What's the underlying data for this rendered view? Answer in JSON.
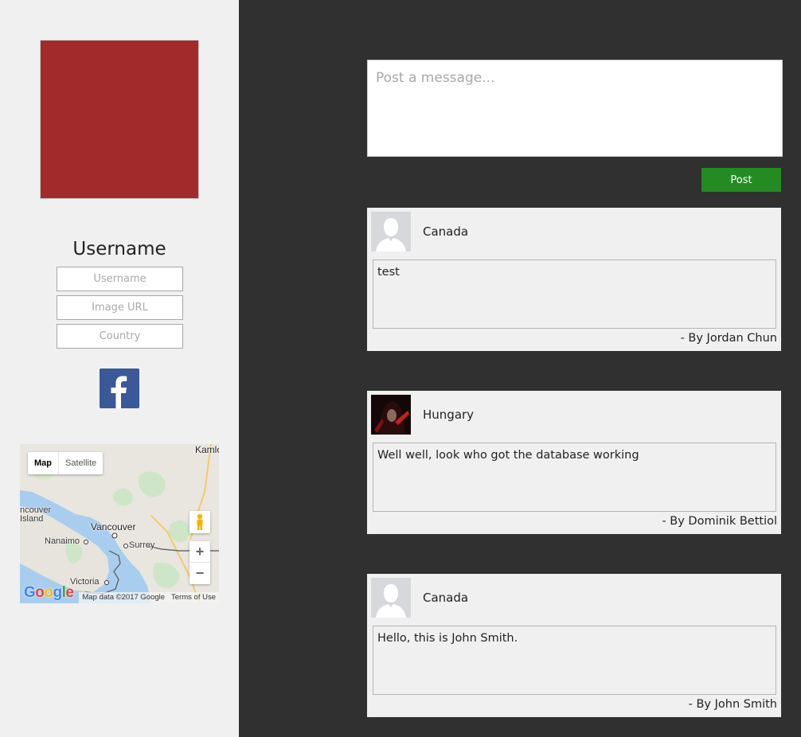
{
  "sidebar": {
    "avatar_color": "#a32a2a",
    "username_heading": "Username",
    "inputs": {
      "username_placeholder": "Username",
      "image_url_placeholder": "Image URL",
      "country_placeholder": "Country"
    },
    "facebook_icon": "facebook-icon",
    "map": {
      "tab_map": "Map",
      "tab_satellite": "Satellite",
      "labels": {
        "kamloops": "Kamlo",
        "vancouver_island": "ncouver\nIsland",
        "vancouver": "Vancouver",
        "nanaimo": "Nanaimo",
        "surrey": "Surrey",
        "victoria": "Victoria"
      },
      "zoom_in": "+",
      "zoom_out": "−",
      "attribution": "Map data ©2017 Google",
      "terms": "Terms of Use",
      "logo": "Google"
    }
  },
  "main": {
    "message_placeholder": "Post a message...",
    "post_button": "Post",
    "post_button_color": "#238b22",
    "posts": [
      {
        "country": "Canada",
        "body": "test",
        "byline": "- By Jordan Chun",
        "avatar": "default-user-icon"
      },
      {
        "country": "Hungary",
        "body": "Well well, look who got the database working",
        "byline": "- By Dominik Bettiol",
        "avatar": "hooded-figure-photo"
      },
      {
        "country": "Canada",
        "body": "Hello, this is John Smith.",
        "byline": "- By John Smith",
        "avatar": "default-user-icon"
      }
    ]
  }
}
